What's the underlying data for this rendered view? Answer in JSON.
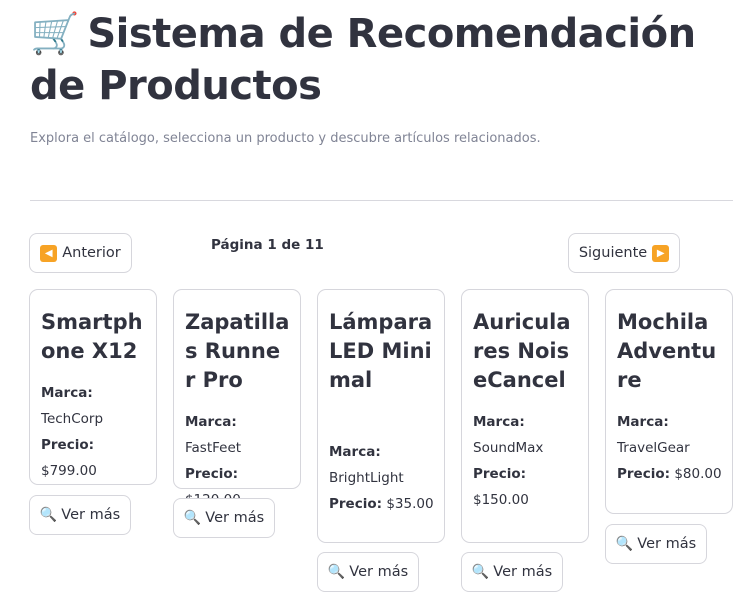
{
  "header": {
    "cart_icon": "🛒",
    "title": "Sistema de Recomendación de Productos",
    "subtitle": "Explora el catálogo, selecciona un producto y descubre artículos relacionados."
  },
  "pagination": {
    "prev_icon": "◀",
    "prev_label": "Anterior",
    "page_indicator": "Página 1 de 11",
    "next_label": "Siguiente",
    "next_icon": "▶"
  },
  "labels": {
    "brand": "Marca:",
    "price": "Precio:",
    "more_icon": "🔍",
    "more_label": "Ver más"
  },
  "products": [
    {
      "name": "Smartphone X12",
      "brand": "TechCorp",
      "price": "$799.00"
    },
    {
      "name": "Zapatillas Runner Pro",
      "brand": "FastFeet",
      "price": "$120.00"
    },
    {
      "name": "Lámpara LED Minimal",
      "brand": "BrightLight",
      "price": "$35.00"
    },
    {
      "name": "Auriculares NoiseCancel",
      "brand": "SoundMax",
      "price": "$150.00"
    },
    {
      "name": "Mochila Adventure",
      "brand": "TravelGear",
      "price": "$80.00"
    }
  ]
}
